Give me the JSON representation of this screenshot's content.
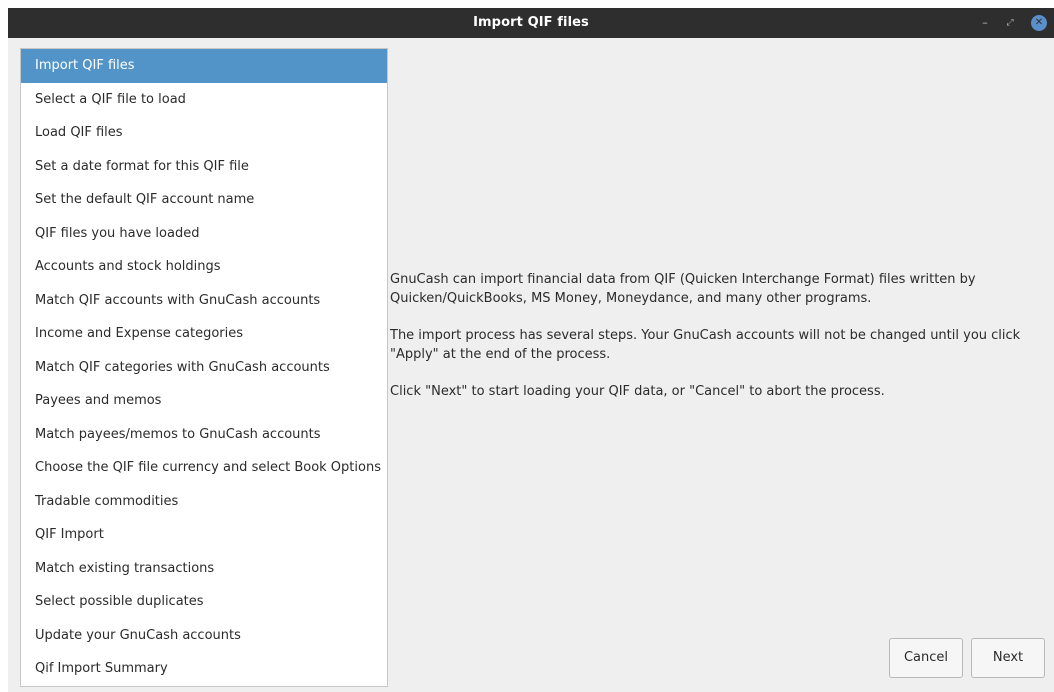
{
  "window": {
    "title": "Import QIF files",
    "controls": {
      "minimize": "–",
      "maximize": "⤢",
      "close": "✕"
    }
  },
  "sidebar": {
    "items": [
      {
        "label": "Import QIF files",
        "active": true
      },
      {
        "label": "Select a QIF file to load",
        "active": false
      },
      {
        "label": "Load QIF files",
        "active": false
      },
      {
        "label": "Set a date format for this QIF file",
        "active": false
      },
      {
        "label": "Set the default QIF account name",
        "active": false
      },
      {
        "label": "QIF files you have loaded",
        "active": false
      },
      {
        "label": "Accounts and stock holdings",
        "active": false
      },
      {
        "label": "Match QIF accounts with GnuCash accounts",
        "active": false
      },
      {
        "label": "Income and Expense categories",
        "active": false
      },
      {
        "label": "Match QIF categories with GnuCash accounts",
        "active": false
      },
      {
        "label": "Payees and memos",
        "active": false
      },
      {
        "label": "Match payees/memos to GnuCash accounts",
        "active": false
      },
      {
        "label": "Choose the QIF file currency and select Book Options",
        "active": false
      },
      {
        "label": "Tradable commodities",
        "active": false
      },
      {
        "label": "QIF Import",
        "active": false
      },
      {
        "label": "Match existing transactions",
        "active": false
      },
      {
        "label": "Select possible duplicates",
        "active": false
      },
      {
        "label": "Update your GnuCash accounts",
        "active": false
      },
      {
        "label": "Qif Import Summary",
        "active": false
      }
    ]
  },
  "content": {
    "paragraph1": "GnuCash can import financial data from QIF (Quicken Interchange Format) files written by Quicken/QuickBooks, MS Money, Moneydance, and many other programs.",
    "paragraph2": "The import process has several steps. Your GnuCash accounts will not be changed until you click \"Apply\" at the end of the process.",
    "paragraph3": "Click \"Next\" to start loading your QIF data, or \"Cancel\" to abort the process."
  },
  "buttons": {
    "cancel": "Cancel",
    "next": "Next"
  },
  "colors": {
    "titlebar": "#2e2e2e",
    "selection": "#5294c8",
    "close_button": "#5b8fc9"
  }
}
